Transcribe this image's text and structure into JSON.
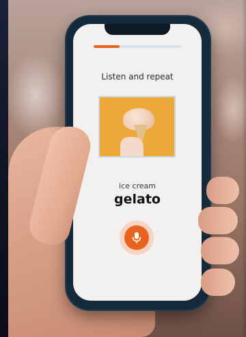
{
  "lesson": {
    "progress_fraction": 0.3,
    "instruction": "Listen and repeat",
    "translation": "ice cream",
    "word": "gelato"
  },
  "icons": {
    "mic": "microphone-icon"
  },
  "colors": {
    "accent": "#e8641e",
    "progress_track": "#d6e3e6",
    "screen_bg": "#f3f1ef",
    "image_bg": "#eda83a"
  }
}
